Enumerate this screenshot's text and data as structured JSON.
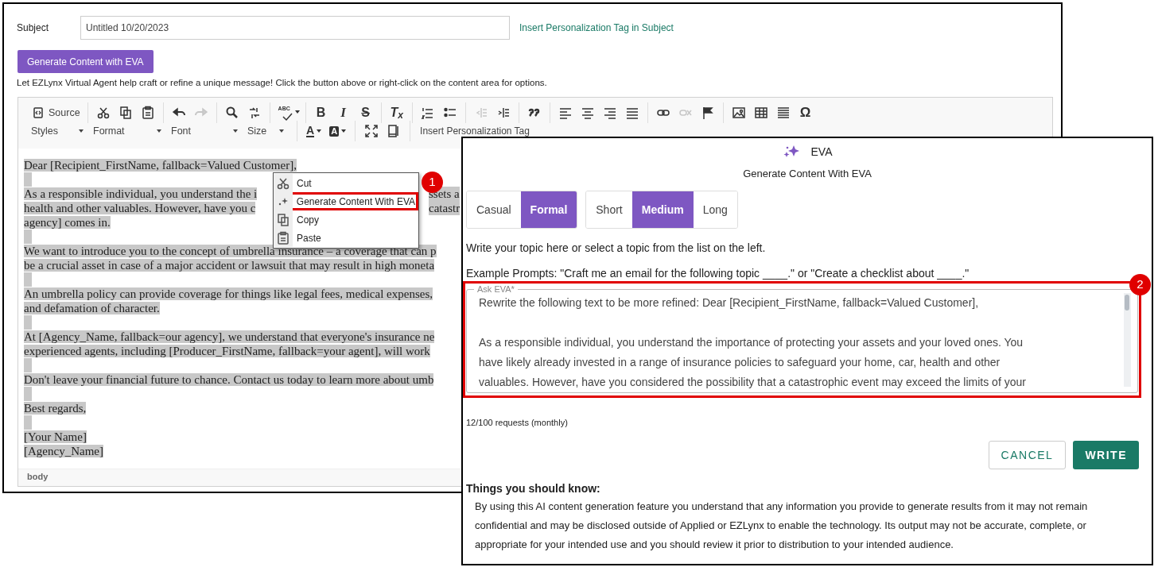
{
  "subject": {
    "label": "Subject",
    "value": "Untitled 10/20/2023",
    "link": "Insert Personalization Tag in Subject"
  },
  "generate_button": "Generate Content with EVA",
  "help_text": "Let EZLynx Virtual Agent help craft or refine a unique message! Click the button above or right-click on the content area for options.",
  "toolbar": {
    "row_1": [
      [
        {
          "label": "Source",
          "disabled": false
        }
      ],
      [
        {
          "disabled": false
        },
        {
          "disabled": false
        },
        {
          "disabled": false
        }
      ],
      [
        {
          "disabled": false
        },
        {
          "disabled": true
        }
      ],
      [
        {
          "disabled": false
        },
        {
          "disabled": false
        }
      ],
      [
        {
          "label": "ABC",
          "disabled": false
        }
      ],
      [
        {
          "label": "B",
          "disabled": false
        },
        {
          "label": "I",
          "disabled": false
        },
        {
          "label": "S",
          "disabled": false
        }
      ],
      [
        {
          "label": "T$_{x}$",
          "disabled": false
        }
      ],
      [
        {
          "disabled": false
        },
        {
          "disabled": false
        }
      ],
      [
        {
          "disabled": true
        },
        {
          "disabled": false
        }
      ],
      [
        {
          "disabled": false
        }
      ],
      [
        {
          "disabled": false
        },
        {
          "disabled": false
        },
        {
          "disabled": false
        },
        {
          "disabled": false
        }
      ],
      [
        {
          "disabled": false
        },
        {
          "disabled": true
        },
        {
          "disabled": false
        }
      ],
      [
        {
          "disabled": false
        },
        {
          "disabled": false
        },
        {
          "disabled": false
        },
        {
          "label": "Ω",
          "disabled": false
        }
      ]
    ],
    "row_2": {
      "dropdowns": [
        {
          "label": "Styles"
        },
        {
          "label": "Format"
        },
        {
          "label": "Font"
        },
        {
          "label": "Size"
        }
      ],
      "colors": [
        {
          "label": "A"
        },
        {
          "label": "A"
        }
      ],
      "tag_button": "Insert Personalization Tag"
    }
  },
  "editor": {
    "lines": [
      {
        "kind": "text",
        "segments": [
          "Dear [Recipient_FirstName, fallback=Valued Customer],"
        ]
      },
      {
        "kind": "blank"
      },
      {
        "kind": "text",
        "segments": [
          "As a responsible individual, you understand the i",
          "ssets a"
        ]
      },
      {
        "kind": "text",
        "segments": [
          "health and other valuables. However, have you c",
          "catastr"
        ]
      },
      {
        "kind": "text",
        "segments": [
          "agency] comes in."
        ]
      },
      {
        "kind": "blank"
      },
      {
        "kind": "text",
        "segments": [
          "We want to introduce you to the concept of umbrella insurance – a coverage that can p"
        ]
      },
      {
        "kind": "text",
        "segments": [
          "be a crucial asset in case of a major accident or lawsuit that may result in high moneta"
        ]
      },
      {
        "kind": "blank"
      },
      {
        "kind": "text",
        "segments": [
          "An umbrella policy can provide coverage for things like legal fees, medical expenses,"
        ]
      },
      {
        "kind": "text",
        "segments": [
          "and defamation of character."
        ]
      },
      {
        "kind": "blank"
      },
      {
        "kind": "text",
        "segments": [
          "At [Agency_Name, fallback=our agency], we understand that everyone's insurance ne"
        ]
      },
      {
        "kind": "text",
        "segments": [
          "experienced agents, including [Producer_FirstName, fallback=your agent], will work"
        ]
      },
      {
        "kind": "blank"
      },
      {
        "kind": "text",
        "segments": [
          "Don't leave your financial future to chance. Contact us today to learn more about umb"
        ]
      },
      {
        "kind": "blank"
      },
      {
        "kind": "text",
        "segments": [
          "Best regards,"
        ]
      },
      {
        "kind": "blank"
      },
      {
        "kind": "text",
        "segments": [
          "[Your Name]"
        ]
      },
      {
        "kind": "text",
        "segments": [
          "[Agency_Name]"
        ]
      }
    ],
    "status": "body"
  },
  "context_menu": [
    {
      "label": "Cut",
      "annotated": false
    },
    {
      "label": "Generate Content With EVA",
      "annotated": true
    },
    {
      "label": "Copy",
      "annotated": false
    },
    {
      "label": "Paste",
      "annotated": false
    }
  ],
  "callouts": [
    {
      "label": "1"
    },
    {
      "label": "2"
    }
  ],
  "eva_panel": {
    "title": "EVA",
    "subtitle": "Generate Content With EVA",
    "tone": [
      {
        "label": "Casual",
        "selected": false
      },
      {
        "label": "Formal",
        "selected": true
      }
    ],
    "length": [
      {
        "label": "Short",
        "selected": false
      },
      {
        "label": "Medium",
        "selected": true
      },
      {
        "label": "Long",
        "selected": false
      }
    ],
    "instruction": "Write your topic here or select a topic from the list on the left.",
    "examples": "Example Prompts: \"Craft me an email for the following topic ____.\" or \"Create a checklist about ____.\"",
    "ask_field": {
      "label": "Ask EVA*",
      "annotated": true,
      "lines": [
        "Rewrite the following text to be more refined: Dear [Recipient_FirstName, fallback=Valued Customer],",
        "As a responsible individual, you understand the importance of protecting your assets and your loved ones. You",
        "have likely already invested in a range of insurance policies to safeguard your home, car, health and other",
        "valuables. However, have you considered the possibility that a catastrophic event may exceed the limits of your"
      ]
    },
    "usage": "12/100 requests (monthly)",
    "buttons": [
      {
        "label": "CANCEL",
        "kind": "secondary"
      },
      {
        "label": "WRITE",
        "kind": "primary"
      }
    ],
    "notice_title": "Things you should know:",
    "notice": "By using this AI content generation feature you understand that any information you provide to generate results from it may not remain confidential and may be disclosed outside of Applied or EZLynx to enable the technology. Its output may not be accurate, complete, or appropriate for your intended use and you should review it prior to distribution to your intended audience."
  }
}
